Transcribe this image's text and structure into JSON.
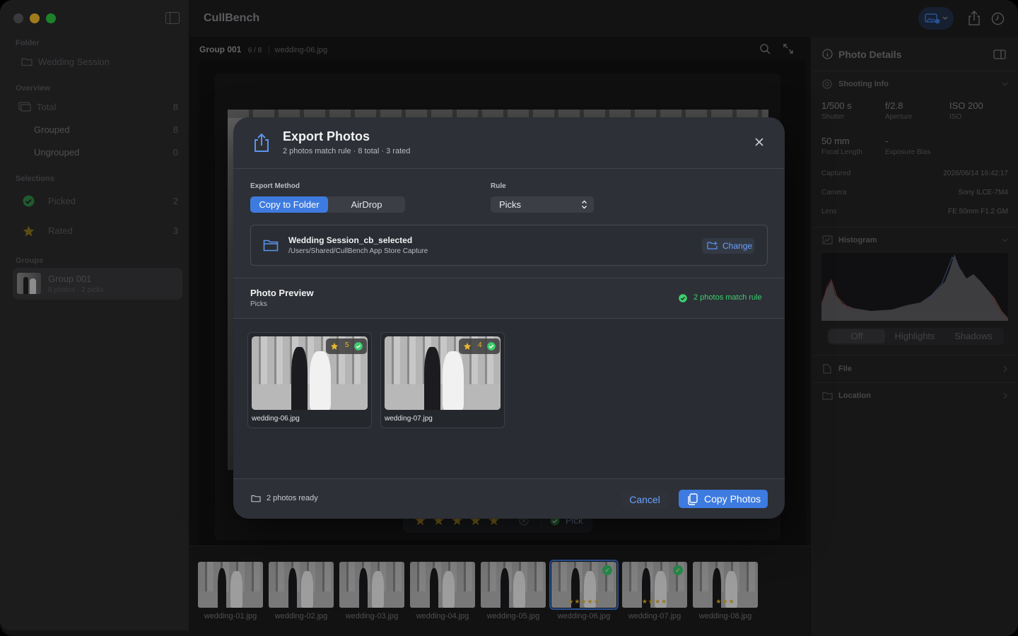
{
  "app": {
    "name": "CullBench"
  },
  "sidebar": {
    "folder_header": "Folder",
    "folder_name": "Wedding Session",
    "overview_header": "Overview",
    "total_label": "Total",
    "total_count": "8",
    "grouped_label": "Grouped",
    "grouped_count": "8",
    "ungrouped_label": "Ungrouped",
    "ungrouped_count": "0",
    "selections_header": "Selections",
    "picked_label": "Picked",
    "picked_count": "2",
    "rated_label": "Rated",
    "rated_count": "3",
    "groups_header": "Groups",
    "group_name": "Group 001",
    "group_meta": "8 photos · 2 picks"
  },
  "breadcrumb": {
    "group": "Group 001",
    "position": "6 / 8",
    "file": "wedding-06.jpg"
  },
  "rating_bar": {
    "pick_label": "Pick"
  },
  "filmstrip": [
    {
      "name": "wedding-01.jpg",
      "stars": "",
      "picked": false,
      "selected": false
    },
    {
      "name": "wedding-02.jpg",
      "stars": "",
      "picked": false,
      "selected": false
    },
    {
      "name": "wedding-03.jpg",
      "stars": "",
      "picked": false,
      "selected": false
    },
    {
      "name": "wedding-04.jpg",
      "stars": "",
      "picked": false,
      "selected": false
    },
    {
      "name": "wedding-05.jpg",
      "stars": "",
      "picked": false,
      "selected": false
    },
    {
      "name": "wedding-06.jpg",
      "stars": "★★★★★",
      "picked": true,
      "selected": true
    },
    {
      "name": "wedding-07.jpg",
      "stars": "★★★★",
      "picked": true,
      "selected": false
    },
    {
      "name": "wedding-08.jpg",
      "stars": "★★★",
      "picked": false,
      "selected": false
    }
  ],
  "details": {
    "title": "Photo Details",
    "shooting_header": "Shooting Info",
    "shutter_value": "1/500 s",
    "shutter_label": "Shutter",
    "aperture_value": "f/2.8",
    "aperture_label": "Aperture",
    "iso_value": "ISO 200",
    "iso_label": "ISO",
    "focal_value": "50 mm",
    "focal_label": "Focal Length",
    "bias_value": "-",
    "bias_label": "Exposure Bias",
    "captured_label": "Captured",
    "captured_value": "2026/06/14 16:42:17",
    "camera_label": "Camera",
    "camera_value": "Sony ILCE-7M4",
    "lens_label": "Lens",
    "lens_value": "FE 50mm F1.2 GM",
    "histogram_header": "Histogram",
    "hist_off": "Off",
    "hist_highlights": "Highlights",
    "hist_shadows": "Shadows",
    "file_header": "File",
    "location_header": "Location"
  },
  "modal": {
    "title": "Export Photos",
    "subtitle": "2 photos match rule · 8 total · 3 rated",
    "export_method_label": "Export Method",
    "method_copy": "Copy to Folder",
    "method_airdrop": "AirDrop",
    "rule_label": "Rule",
    "rule_value": "Picks",
    "dest_name": "Wedding Session_cb_selected",
    "dest_path": "/Users/Shared/CullBench App Store Capture",
    "change_label": "Change",
    "preview_title": "Photo Preview",
    "preview_sub": "Picks",
    "match_text": "2 photos match rule",
    "photos": [
      {
        "name": "wedding-06.jpg",
        "rating": "5"
      },
      {
        "name": "wedding-07.jpg",
        "rating": "4"
      }
    ],
    "ready_text": "2 photos ready",
    "cancel_label": "Cancel",
    "copy_label": "Copy Photos"
  },
  "colors": {
    "accent": "#3e7be0",
    "pick_green": "#3ccf6e",
    "star_gold": "#e9b92c"
  }
}
